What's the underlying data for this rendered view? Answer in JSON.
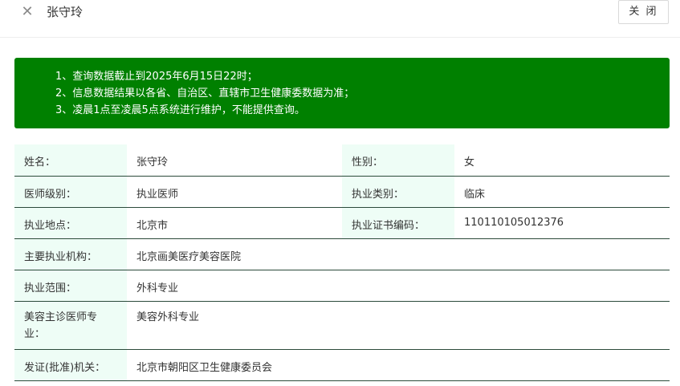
{
  "header": {
    "title": "张守玲",
    "close_label": "关 闭"
  },
  "notice": {
    "lines": [
      "1、查询数据截止到2025年6月15日22时；",
      "2、信息数据结果以各省、自治区、直辖市卫生健康委数据为准；",
      "3、凌晨1点至凌晨5点系统进行维护，不能提供查询。"
    ]
  },
  "info": {
    "name_label": "姓名：",
    "name_value": "张守玲",
    "gender_label": "性别：",
    "gender_value": "女",
    "level_label": "医师级别：",
    "level_value": "执业医师",
    "category_label": "执业类别：",
    "category_value": "临床",
    "location_label": "执业地点：",
    "location_value": "北京市",
    "cert_label": "执业证书编码：",
    "cert_value": "110110105012376",
    "institution_label": "主要执业机构：",
    "institution_value": "北京画美医疗美容医院",
    "scope_label": "执业范围：",
    "scope_value": "外科专业",
    "cosmetic_label": "美容主诊医师专业：",
    "cosmetic_value": "美容外科专业",
    "issuer_label": "发证(批准)机关：",
    "issuer_value": "北京市朝阳区卫生健康委员会"
  }
}
